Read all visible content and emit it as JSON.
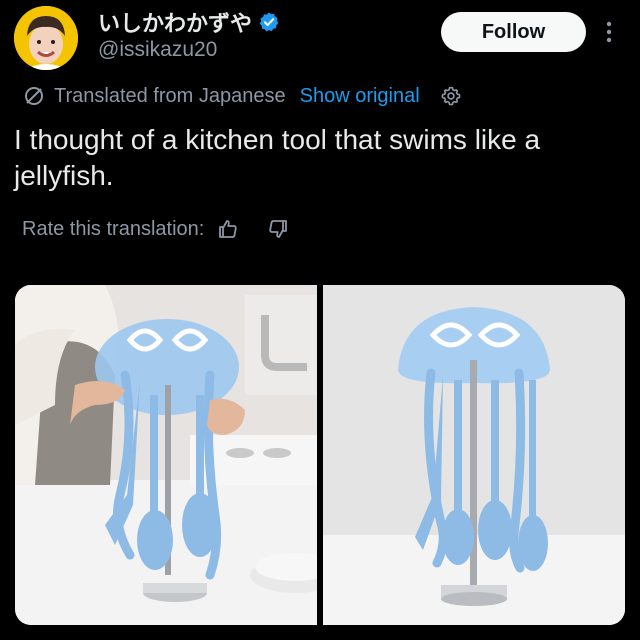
{
  "author": {
    "display_name": "いしかわかずや",
    "handle": "@issikazu20",
    "verified_icon": "verified-badge-icon"
  },
  "actions": {
    "follow_label": "Follow",
    "more_icon": "more-vertical-icon"
  },
  "translation": {
    "icon": "slash-circle-icon",
    "translated_label": "Translated from Japanese",
    "show_original_label": "Show original",
    "settings_icon": "gear-icon"
  },
  "tweet": {
    "text": "I thought of a kitchen tool that swims like a jellyfish."
  },
  "rating": {
    "label": "Rate this translation:",
    "up_icon": "thumbs-up-icon",
    "down_icon": "thumbs-down-icon"
  },
  "media": {
    "images": [
      "hand-holding-jellyfish-utensil-stand",
      "jellyfish-utensil-stand-product-shot"
    ]
  },
  "colors": {
    "background": "#000000",
    "text": "#e7e9ea",
    "muted": "#8b98a5",
    "link": "#1d9bf0",
    "verified": "#1d9bf0",
    "jelly": "#9cc8ee"
  }
}
